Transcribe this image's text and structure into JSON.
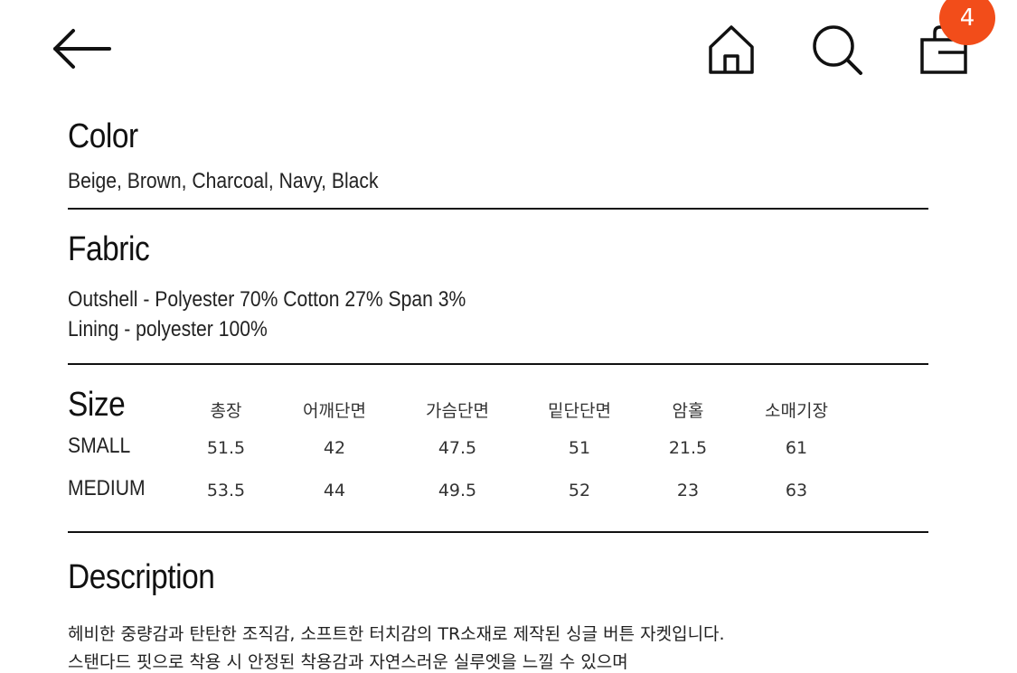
{
  "header": {
    "back_icon": "arrow-left-icon",
    "home_icon": "home-icon",
    "search_icon": "search-icon",
    "cart_icon": "shopping-bag-icon",
    "cart_count": "4",
    "badge_color": "#f24d1a"
  },
  "color_section": {
    "title": "Color",
    "value": "Beige, Brown, Charcoal, Navy, Black"
  },
  "fabric_section": {
    "title": "Fabric",
    "lines": [
      "Outshell - Polyester 70% Cotton 27% Span 3%",
      "Lining - polyester 100%"
    ]
  },
  "size_section": {
    "title": "Size",
    "columns": [
      "총장",
      "어깨단면",
      "가슴단면",
      "밑단단면",
      "암홀",
      "소매기장"
    ],
    "rows": [
      {
        "label": "SMALL",
        "values": [
          "51.5",
          "42",
          "47.5",
          "51",
          "21.5",
          "61"
        ]
      },
      {
        "label": "MEDIUM",
        "values": [
          "53.5",
          "44",
          "49.5",
          "52",
          "23",
          "63"
        ]
      }
    ]
  },
  "description_section": {
    "title": "Description",
    "lines": [
      "헤비한 중량감과 탄탄한 조직감, 소프트한 터치감의 TR소재로 제작된 싱글 버튼 자켓입니다.",
      "스탠다드 핏으로 착용 시 안정된 착용감과 자연스러운 실루엣을 느낄 수 있으며"
    ]
  }
}
